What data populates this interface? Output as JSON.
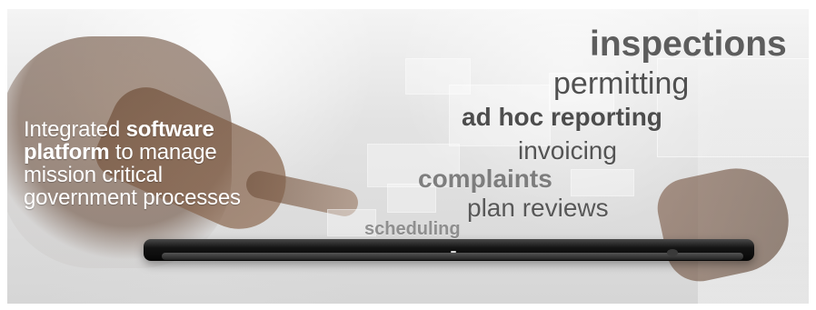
{
  "banner": {
    "caption": {
      "line1_prefix": "Integrated ",
      "line1_strong": "software",
      "line2_strong": "platform",
      "line2_suffix": " to manage",
      "line3": "mission critical",
      "line4": "government processes"
    },
    "keywords": {
      "inspections": "inspections",
      "permitting": "permitting",
      "ad_hoc_reporting": "ad hoc reporting",
      "invoicing": "invoicing",
      "complaints": "complaints",
      "plan_reviews": "plan reviews",
      "scheduling": "scheduling"
    }
  }
}
